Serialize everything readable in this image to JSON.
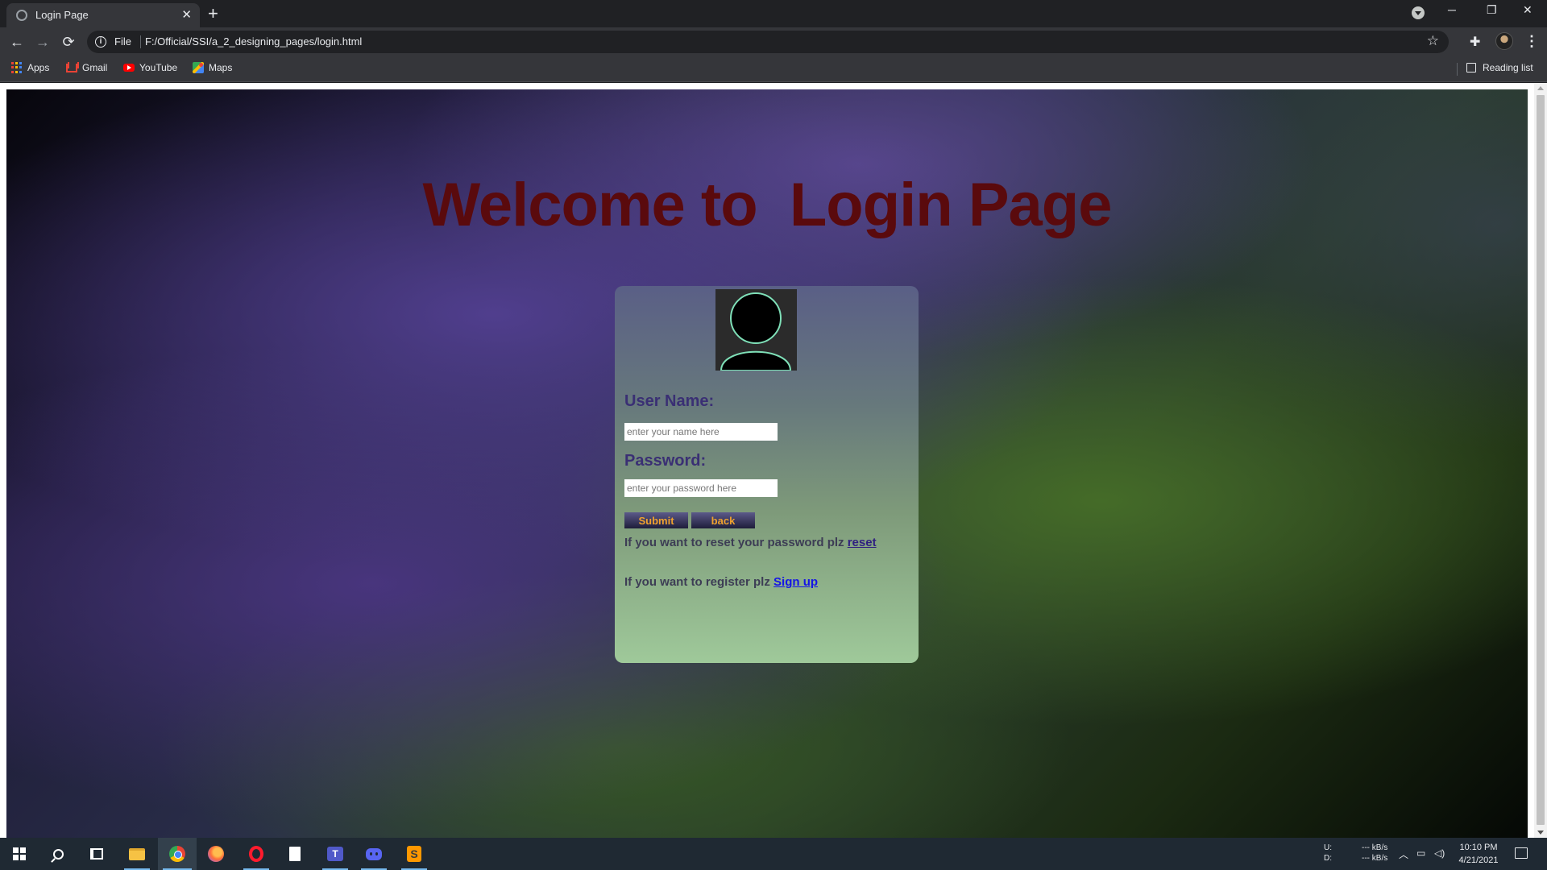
{
  "browser": {
    "tab_title": "Login Page",
    "tab_close": "✕",
    "new_tab": "+",
    "window_controls": {
      "minimize": "─",
      "restore": "❐",
      "close": "✕"
    },
    "nav": {
      "back": "←",
      "forward": "→",
      "reload": "⟳"
    },
    "omnibox": {
      "info": "i",
      "scheme_label": "File",
      "url": "F:/Official/SSI/a_2_designing_pages/login.html",
      "star": "☆"
    },
    "extensions_icon": "✚",
    "menu_icon": "⋮",
    "bookmarks": [
      {
        "label": "Apps",
        "icon": "apps-grid-icon"
      },
      {
        "label": "Gmail",
        "icon": "gmail-icon"
      },
      {
        "label": "YouTube",
        "icon": "youtube-icon"
      },
      {
        "label": "Maps",
        "icon": "maps-icon"
      }
    ],
    "reading_list": "Reading list"
  },
  "page": {
    "heading": "Welcome to  Login Page",
    "form": {
      "username_label": "User Name:",
      "username_placeholder": "enter your name here",
      "username_value": "",
      "password_label": "Password:",
      "password_placeholder": "enter your password here",
      "password_value": "",
      "submit_label": "Submit",
      "back_label": "back",
      "reset_text": "If you want to reset your password plz ",
      "reset_link": "reset",
      "register_text": "If you want to register plz ",
      "signup_link": "Sign up"
    }
  },
  "taskbar": {
    "apps": [
      "start-icon",
      "search-icon",
      "task-view-icon",
      "file-explorer-icon",
      "chrome-icon",
      "firefox-icon",
      "opera-icon",
      "file-icon",
      "teams-icon",
      "discord-icon",
      "sublime-text-icon"
    ],
    "teams_letter": "T",
    "sublime_letter": "S",
    "net_upload_label": "U:",
    "net_download_label": "D:",
    "net_upload_value": "--- kB/s",
    "net_download_value": "--- kB/s",
    "tray_chevron": "︿",
    "time": "10:10 PM",
    "date": "4/21/2021"
  },
  "colors": {
    "heading": "#5a0a0d",
    "labels": "#3a2f74",
    "button_text": "#f0a22e",
    "signup_link": "#1414e6"
  }
}
